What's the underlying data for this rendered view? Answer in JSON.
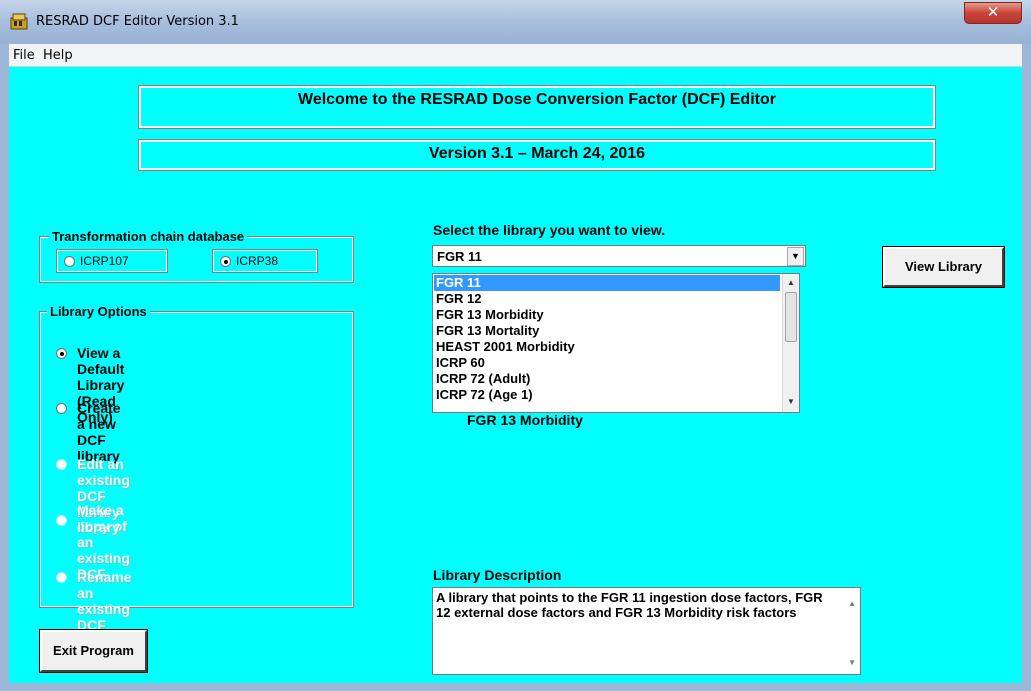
{
  "window": {
    "title": "RESRAD DCF Editor Version 3.1",
    "close_glyph": "✕"
  },
  "menu": {
    "items": [
      "File",
      "Help"
    ]
  },
  "banners": {
    "welcome": "Welcome to the RESRAD Dose Conversion Factor (DCF) Editor",
    "version": "Version 3.1 – March 24, 2016"
  },
  "transformation": {
    "title": "Transformation chain database",
    "options": [
      {
        "label": "ICRP107",
        "checked": false
      },
      {
        "label": "ICRP38",
        "checked": true
      }
    ]
  },
  "library_options": {
    "title": "Library Options",
    "options": [
      {
        "label": "View a Default Library (Read Only)",
        "checked": true,
        "enabled": true
      },
      {
        "label": "Create a new DCF library",
        "checked": false,
        "enabled": true
      },
      {
        "label": "Edit an existing DCF library",
        "checked": false,
        "enabled": false
      },
      {
        "label_line1": "Make a copy of an existing DCF",
        "label_line2": "library",
        "checked": false,
        "enabled": false
      },
      {
        "label": "Rename an existing DCF library",
        "checked": false,
        "enabled": false
      }
    ]
  },
  "library_select": {
    "prompt": "Select the library you want to view.",
    "selected": "FGR 11",
    "items": [
      "FGR 11",
      "FGR 12",
      "FGR 13 Morbidity",
      "FGR 13 Mortality",
      "HEAST 2001 Morbidity",
      "ICRP 60",
      "ICRP 72 (Adult)",
      "ICRP 72 (Age 1)"
    ],
    "behind_text": "FGR 13 Morbidity"
  },
  "view_library_button": "View Library",
  "description": {
    "label": "Library Description",
    "text": "A library that points to the FGR 11 ingestion dose factors, FGR 12 external dose factors and FGR 13 Morbidity risk factors"
  },
  "exit_button": "Exit Program",
  "colors": {
    "client_bg": "#00ffff",
    "selection": "#3399ff"
  }
}
